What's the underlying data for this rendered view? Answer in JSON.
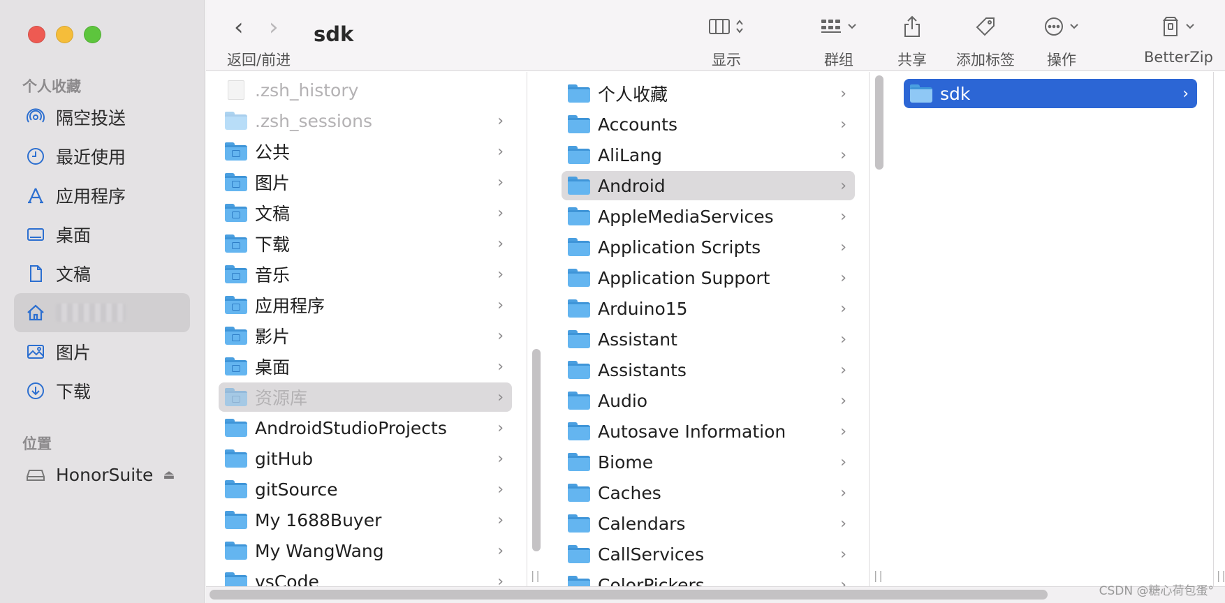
{
  "window": {
    "title": "sdk"
  },
  "toolbar": {
    "nav_label": "返回/前进",
    "view_label": "显示",
    "group_label": "群组",
    "share_label": "共享",
    "tags_label": "添加标签",
    "action_label": "操作",
    "betterzip_label": "BetterZip"
  },
  "sidebar": {
    "favorites_title": "个人收藏",
    "favorites": [
      {
        "label": "隔空投送",
        "icon": "airdrop-icon"
      },
      {
        "label": "最近使用",
        "icon": "clock-icon"
      },
      {
        "label": "应用程序",
        "icon": "applications-icon"
      },
      {
        "label": "桌面",
        "icon": "desktop-icon"
      },
      {
        "label": "文稿",
        "icon": "document-icon"
      },
      {
        "label": "",
        "icon": "home-icon",
        "selected": true
      },
      {
        "label": "图片",
        "icon": "photo-icon"
      },
      {
        "label": "下载",
        "icon": "download-icon"
      }
    ],
    "locations_title": "位置",
    "locations": [
      {
        "label": "HonorSuite",
        "icon": "drive-icon"
      }
    ]
  },
  "columns": {
    "home": [
      ".zsh_history",
      ".zsh_sessions",
      "公共",
      "图片",
      "文稿",
      "下载",
      "音乐",
      "应用程序",
      "影片",
      "桌面",
      "资源库",
      "AndroidStudioProjects",
      "gitHub",
      "gitSource",
      "My 1688Buyer",
      "My WangWang",
      "vsCode"
    ],
    "library": [
      "个人收藏",
      "Accounts",
      "AliLang",
      "Android",
      "AppleMediaServices",
      "Application Scripts",
      "Application Support",
      "Arduino15",
      "Assistant",
      "Assistants",
      "Audio",
      "Autosave Information",
      "Biome",
      "Caches",
      "Calendars",
      "CallServices",
      "ColorPickers"
    ],
    "android": [
      "sdk"
    ]
  },
  "watermark": "CSDN @糖心荷包蛋°",
  "colors": {
    "accent": "#2c66d5",
    "folder": "#64b5f0",
    "sidebar_bg": "#e4e2e4"
  }
}
